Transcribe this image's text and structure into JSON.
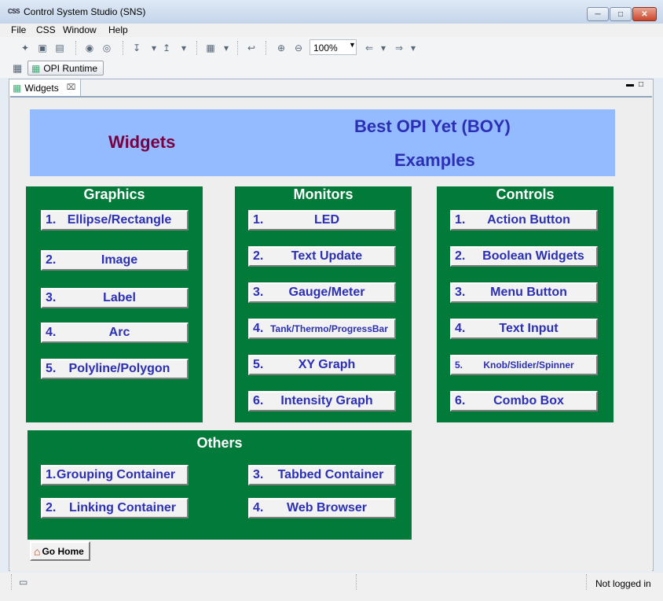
{
  "window": {
    "title": "Control System Studio (SNS)",
    "logo": "CSS"
  },
  "menu": [
    "File",
    "CSS",
    "Window",
    "Help"
  ],
  "toolbar": {
    "zoom": "100%"
  },
  "perspective": {
    "label": "OPI Runtime"
  },
  "tab": {
    "label": "Widgets"
  },
  "header": {
    "left": "Widgets",
    "line1": "Best OPI Yet (BOY)",
    "line2": "Examples"
  },
  "panels": {
    "graphics": {
      "title": "Graphics",
      "items": [
        {
          "num": "1.",
          "label": "Ellipse/Rectangle"
        },
        {
          "num": "2.",
          "label": "Image"
        },
        {
          "num": "3.",
          "label": "Label"
        },
        {
          "num": "4.",
          "label": "Arc"
        },
        {
          "num": "5.",
          "label": "Polyline/Polygon"
        }
      ]
    },
    "monitors": {
      "title": "Monitors",
      "items": [
        {
          "num": "1.",
          "label": "LED"
        },
        {
          "num": "2.",
          "label": "Text Update"
        },
        {
          "num": "3.",
          "label": "Gauge/Meter"
        },
        {
          "num": "4.",
          "label": "Tank/Thermo/ProgressBar"
        },
        {
          "num": "5.",
          "label": "XY Graph"
        },
        {
          "num": "6.",
          "label": "Intensity Graph"
        }
      ]
    },
    "controls": {
      "title": "Controls",
      "items": [
        {
          "num": "1.",
          "label": "Action Button"
        },
        {
          "num": "2.",
          "label": "Boolean Widgets"
        },
        {
          "num": "3.",
          "label": "Menu Button"
        },
        {
          "num": "4.",
          "label": "Text Input"
        },
        {
          "num": "5.",
          "label": "Knob/Slider/Spinner"
        },
        {
          "num": "6.",
          "label": "Combo Box"
        }
      ]
    },
    "others": {
      "title": "Others",
      "items": [
        {
          "num": "1.",
          "label": "Grouping Container"
        },
        {
          "num": "2.",
          "label": "Linking Container"
        },
        {
          "num": "3.",
          "label": "Tabbed Container"
        },
        {
          "num": "4.",
          "label": "Web Browser"
        }
      ]
    }
  },
  "go_home": "Go Home",
  "status": "Not logged in",
  "colors": {
    "panel_green": "#017a3a",
    "header_blue": "#94bbff",
    "button_text": "#2b2fb5",
    "title_maroon": "#7a0040"
  }
}
